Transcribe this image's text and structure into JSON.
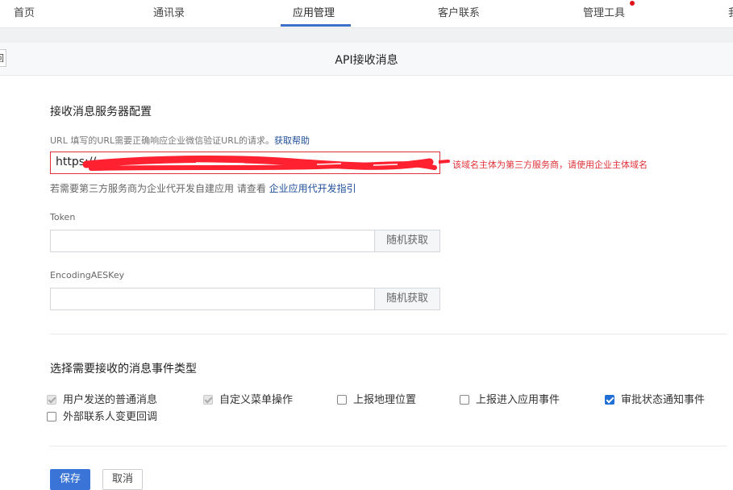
{
  "nav": {
    "items": [
      {
        "label": "首页"
      },
      {
        "label": "通讯录"
      },
      {
        "label": "应用管理"
      },
      {
        "label": "客户联系"
      },
      {
        "label": "管理工具"
      },
      {
        "label": "我"
      }
    ],
    "active": "应用管理",
    "colors": {
      "accent": "#3b6fc9",
      "notice_dot": "#e0131a"
    }
  },
  "subheader": {
    "back_label": "返回",
    "title": "API接收消息"
  },
  "server_config": {
    "title": "接收消息服务器配置",
    "url_hint_prefix": "URL  填写的URL需要正确响应企业微信验证URL的请求。",
    "url_help_link": "获取帮助",
    "url_value": "https://",
    "url_error": "该域名主体为第三方服务商，请使用企业主体域名",
    "third_party_hint": "若需要第三方服务商为企业代开发自建应用 请查看",
    "third_party_link": "企业应用代开发指引",
    "token_label": "Token",
    "token_value": "",
    "token_random_button": "随机获取",
    "aes_label": "EncodingAESKey",
    "aes_value": "",
    "aes_random_button": "随机获取",
    "colors": {
      "error": "#e0323a",
      "link": "#1f4e99"
    }
  },
  "event_types": {
    "title": "选择需要接收的消息事件类型",
    "options": [
      {
        "label": "用户发送的普通消息",
        "checked": true,
        "disabled": true
      },
      {
        "label": "自定义菜单操作",
        "checked": true,
        "disabled": true
      },
      {
        "label": "上报地理位置",
        "checked": false,
        "disabled": false
      },
      {
        "label": "上报进入应用事件",
        "checked": false,
        "disabled": false
      },
      {
        "label": "审批状态通知事件",
        "checked": true,
        "disabled": false
      },
      {
        "label": "外部联系人变更回调",
        "checked": false,
        "disabled": false
      }
    ]
  },
  "actions": {
    "save": "保存",
    "cancel": "取消"
  }
}
